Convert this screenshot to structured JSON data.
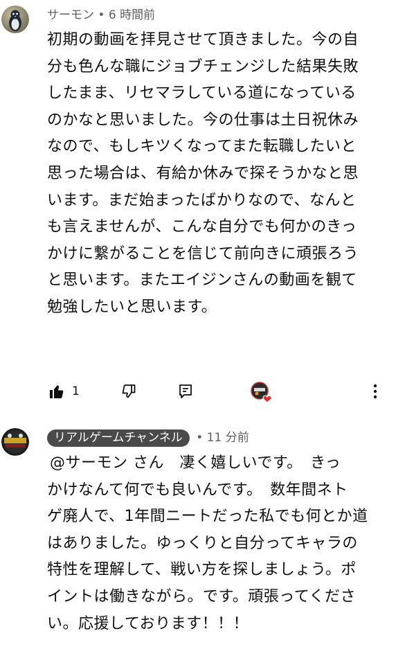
{
  "comments": [
    {
      "author": "サーモン",
      "separator": "•",
      "time": "6 時間前",
      "lines": [
        "初期の動画を拝見させて頂きました。今の自",
        "分も色んな職にジョブチェンジした結果失敗",
        "したまま、リセマラしている道になっている",
        "のかなと思いました。今の仕事は土日祝休み",
        "なので、もしキツくなってまた転職したいと",
        "思った場合は、有給か休みで探そうかなと思",
        "います。まだ始まったばかりなので、なんと",
        "も言えませんが、こんな自分でも何かのきっ",
        "かけに繋がることを信じて前向きに頑張ろう",
        "と思います。またエイジンさんの動画を観て",
        "勉強したいと思います。"
      ],
      "like_count": "1",
      "icons": {
        "like": "thumbs-up-icon",
        "dislike": "thumbs-down-icon",
        "reply": "reply-comment-icon",
        "creator_heart": "creator-heart-icon",
        "more": "more-vertical-icon"
      }
    },
    {
      "author": "リアルゲームチャンネル",
      "separator": "•",
      "time": "11 分前",
      "lines": [
        "@サーモン さん　凄く嬉しいです。　きっ",
        "かけなんて何でも良いんです。　数年間ネト",
        "ゲ廃人で、1年間ニートだった私でも何とか道",
        "はありました。ゆっくりと自分ってキャラの",
        "特性を理解して、戦い方を探しましょう。ポ",
        "イントは働きながら。です。頑張ってくださ",
        "い。応援しております！！！"
      ]
    }
  ],
  "colors": {
    "text": "#0f0f0f",
    "meta": "#606060",
    "creator_chip_bg": "#4a4a4a",
    "creator_chip_text": "#ffffff",
    "heart": "#e52d27"
  }
}
